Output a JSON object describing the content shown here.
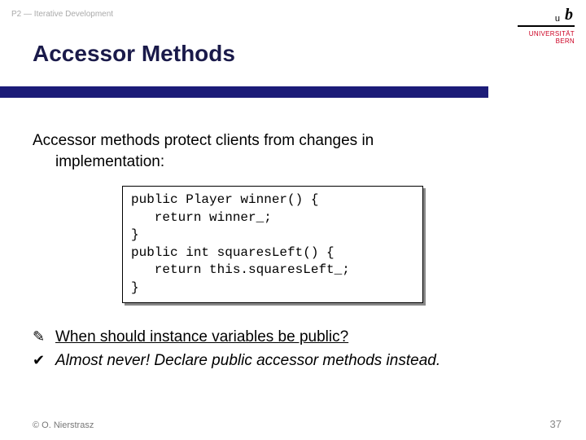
{
  "header": {
    "label": "P2 — Iterative Development"
  },
  "logo": {
    "b": "b",
    "u": "u",
    "line1": "UNIVERSITÄT",
    "line2": "BERN"
  },
  "title": "Accessor Methods",
  "body": {
    "line1": "Accessor methods protect clients from changes in",
    "line2": "implementation:"
  },
  "code": {
    "l1": "public Player winner() {",
    "l2": "   return winner_;",
    "l3": "}",
    "l4": "public int squaresLeft() {",
    "l5": "   return this.squaresLeft_;",
    "l6": "}"
  },
  "qa": {
    "q_icon": "✎",
    "q": "When should instance variables be public?",
    "a_icon": "✔",
    "a": "Almost never! Declare public accessor methods instead."
  },
  "footer": {
    "copyright": "© O. Nierstrasz",
    "page": "37"
  }
}
